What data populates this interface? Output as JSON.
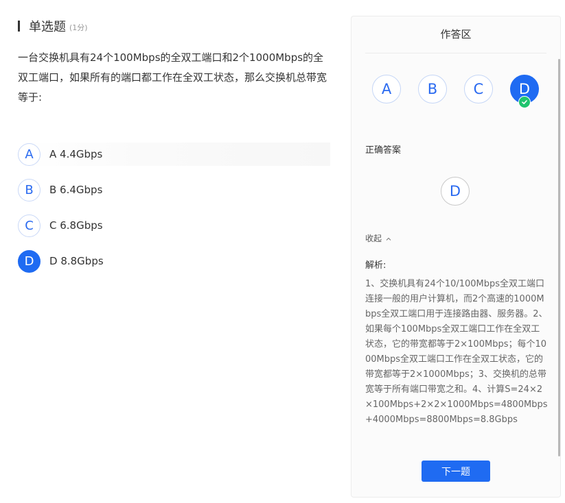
{
  "question": {
    "type": "单选题",
    "score": "(1分)",
    "stem": "一台交换机具有24个100Mbps的全双工端口和2个1000Mbps的全双工端口，如果所有的端口都工作在全双工状态，那么交换机总带宽等于:",
    "options": [
      {
        "letter": "A",
        "text": "A 4.4Gbps",
        "selected": false
      },
      {
        "letter": "B",
        "text": "B 6.4Gbps",
        "selected": false
      },
      {
        "letter": "C",
        "text": "C 6.8Gbps",
        "selected": false
      },
      {
        "letter": "D",
        "text": "D 8.8Gbps",
        "selected": true
      }
    ]
  },
  "panel": {
    "title": "作答区",
    "answer_choices": [
      "A",
      "B",
      "C",
      "D"
    ],
    "selected_choice": "D",
    "correct_label": "正确答案",
    "correct_answer": "D",
    "collapse_label": "收起",
    "analysis_label": "解析:",
    "analysis_text": "1、交换机具有24个10/100Mbps全双工端口连接一般的用户计算机，而2个高速的1000Mbps全双工端口用于连接路由器、服务器。2、如果每个100Mbps全双工端口工作在全双工状态，它的带宽都等于2×100Mbps；每个1000Mbps全双工端口工作在全双工状态，它的带宽都等于2×1000Mbps；3、交换机的总带宽等于所有端口带宽之和。4、计算S=24×2×100Mbps+2×2×1000Mbps=4800Mbps+4000Mbps=8800Mbps=8.8Gbps",
    "next_button": "下一题"
  },
  "colors": {
    "primary": "#1f6bf2",
    "success": "#1fc46e",
    "text": "#333333",
    "muted": "#999999"
  }
}
